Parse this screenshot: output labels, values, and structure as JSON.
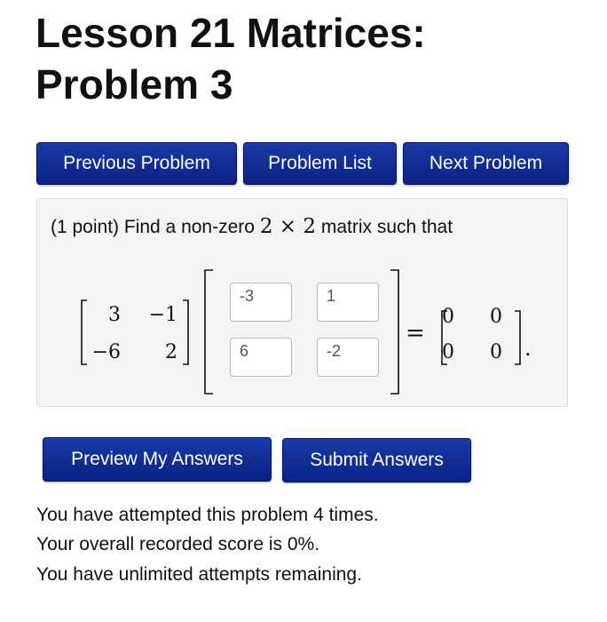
{
  "page": {
    "title": "Lesson 21 Matrices: Problem 3"
  },
  "nav": {
    "previous_label": "Previous Problem",
    "list_label": "Problem List",
    "next_label": "Next Problem"
  },
  "problem": {
    "points_text": "(1 point) Find a non-zero",
    "dimension_text": "2 × 2",
    "rest_text": "matrix such that",
    "matrix_a": [
      [
        "3",
        "−1"
      ],
      [
        "−6",
        "2"
      ]
    ],
    "answers": [
      [
        "-3",
        "1"
      ],
      [
        "6",
        "-2"
      ]
    ],
    "equals": "=",
    "zero_matrix": [
      [
        "0",
        "0"
      ],
      [
        "0",
        "0"
      ]
    ],
    "period": "."
  },
  "actions": {
    "preview_label": "Preview My Answers",
    "submit_label": "Submit Answers"
  },
  "status": {
    "attempts": "You have attempted this problem 4 times.",
    "score": "Your overall recorded score is 0%.",
    "remaining": "You have unlimited attempts remaining."
  },
  "colors": {
    "button_bg": "#0b2185",
    "panel_bg": "#f4f4f4"
  }
}
